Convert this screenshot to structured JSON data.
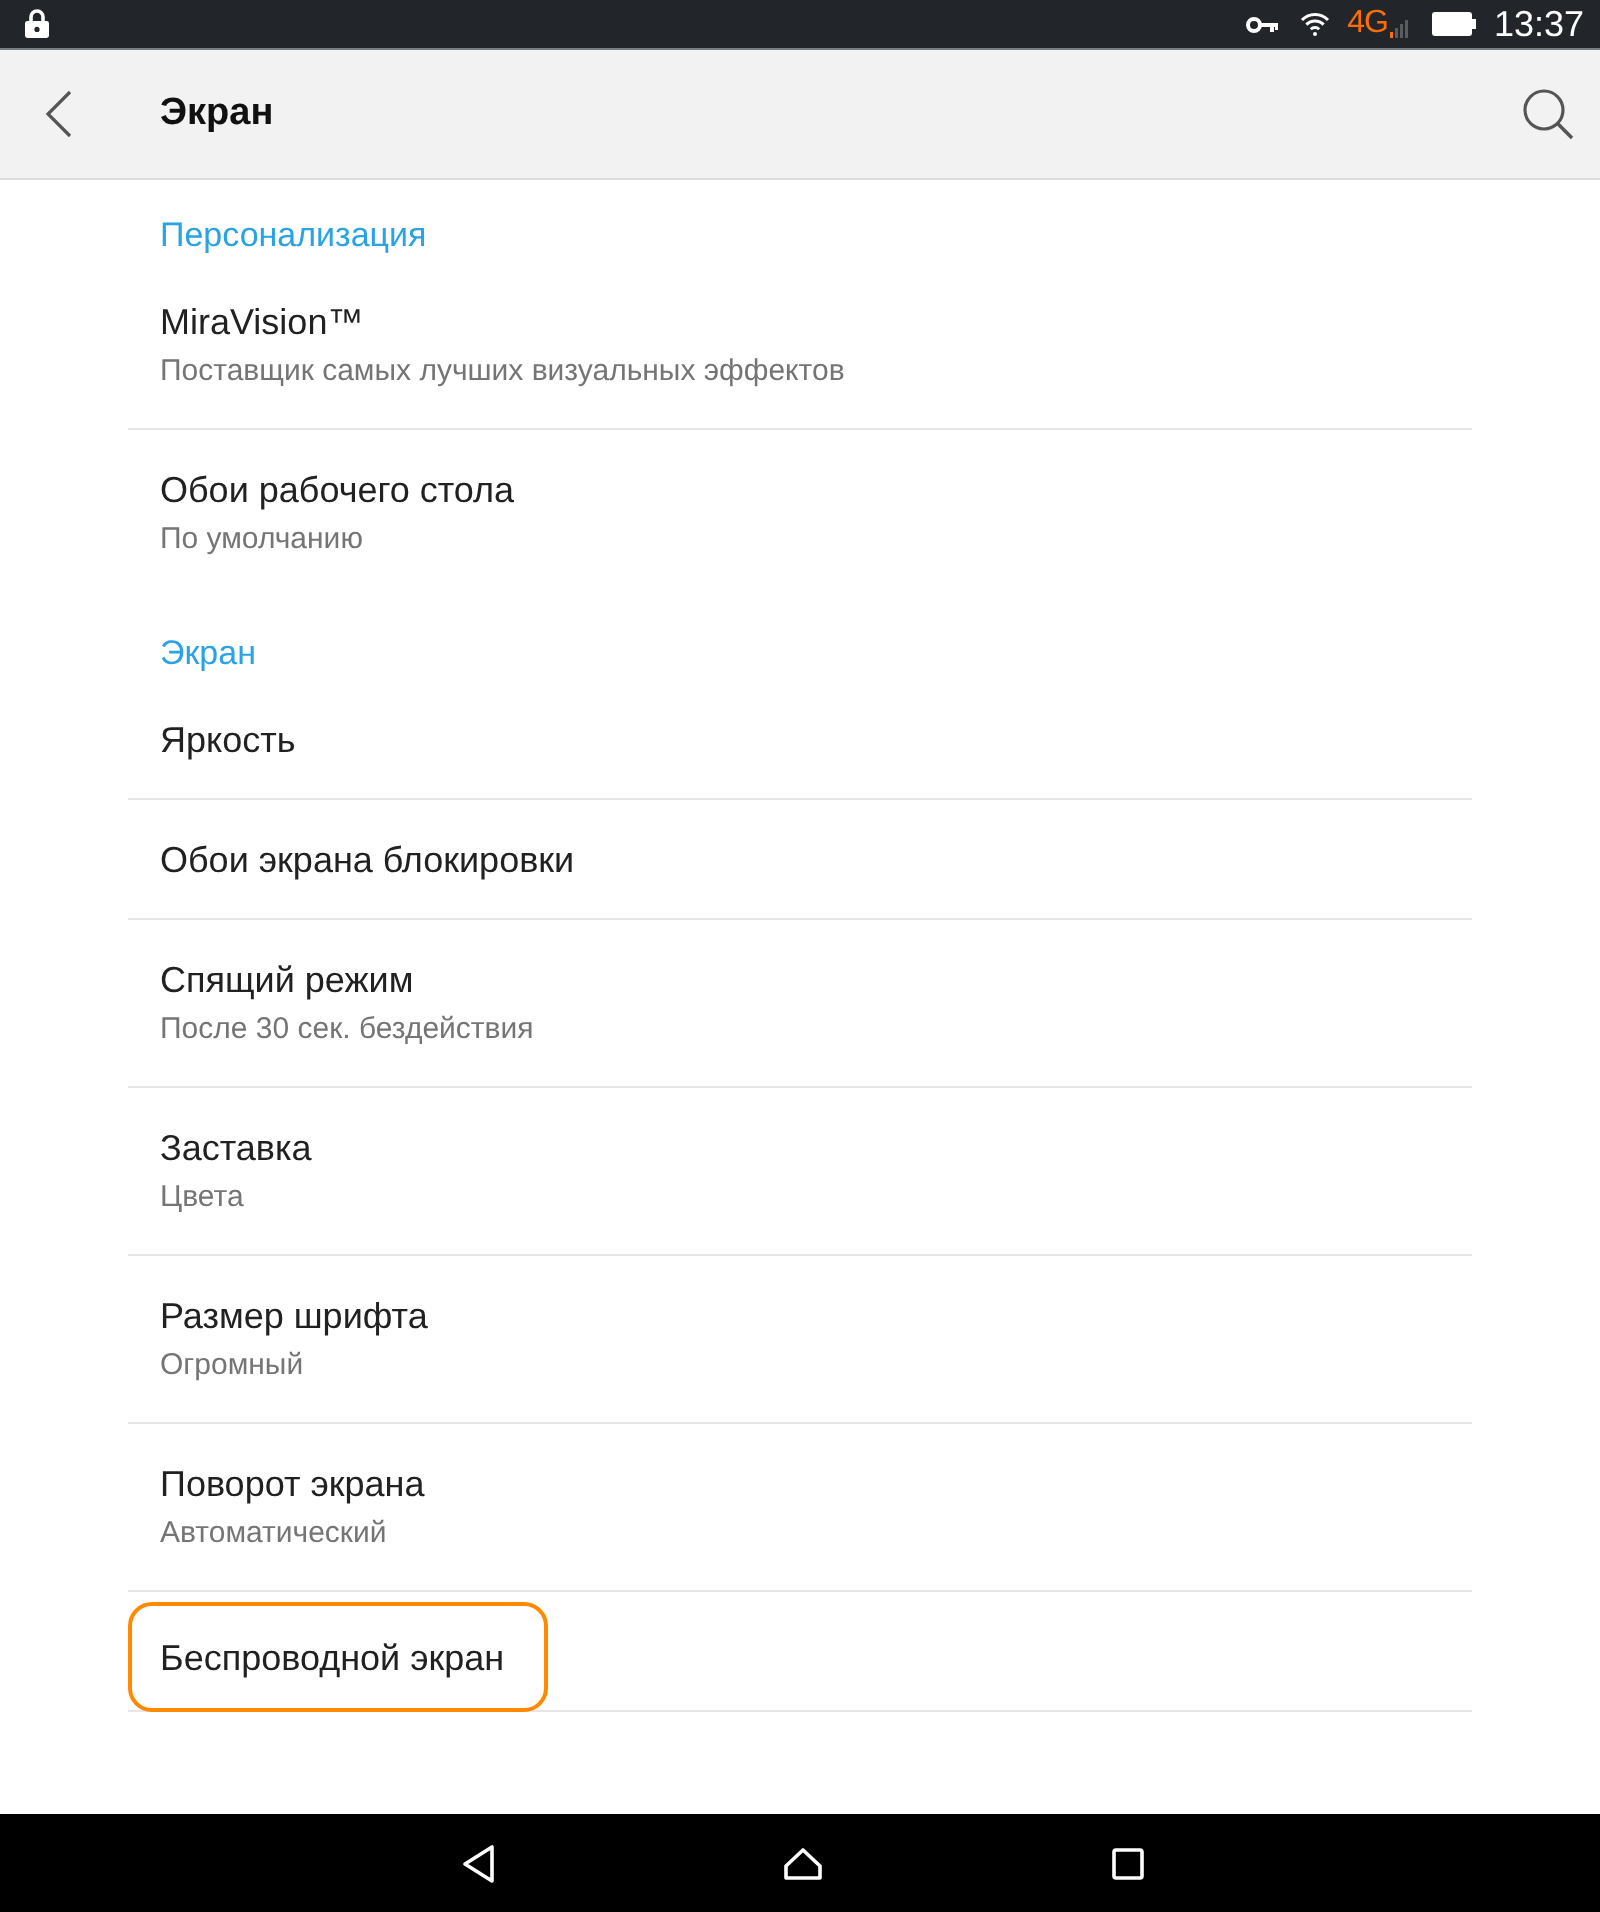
{
  "status_bar": {
    "network": "4G",
    "time": "13:37"
  },
  "app_bar": {
    "title": "Экран"
  },
  "sections": [
    {
      "header": "Персонализация",
      "items": [
        {
          "title": "MiraVision™",
          "subtitle": "Поставщик самых лучших визуальных эффектов",
          "highlighted": false
        },
        {
          "title": "Обои рабочего стола",
          "subtitle": "По умолчанию",
          "highlighted": false
        }
      ]
    },
    {
      "header": "Экран",
      "items": [
        {
          "title": "Яркость",
          "highlighted": false
        },
        {
          "title": "Обои экрана блокировки",
          "highlighted": false
        },
        {
          "title": "Спящий режим",
          "subtitle": "После 30 сек. бездействия",
          "highlighted": false
        },
        {
          "title": "Заставка",
          "subtitle": "Цвета",
          "highlighted": false
        },
        {
          "title": "Размер шрифта",
          "subtitle": "Огромный",
          "highlighted": false
        },
        {
          "title": "Поворот экрана",
          "subtitle": "Автоматический",
          "highlighted": false
        },
        {
          "title": "Беспроводной экран",
          "highlighted": true
        }
      ]
    }
  ]
}
